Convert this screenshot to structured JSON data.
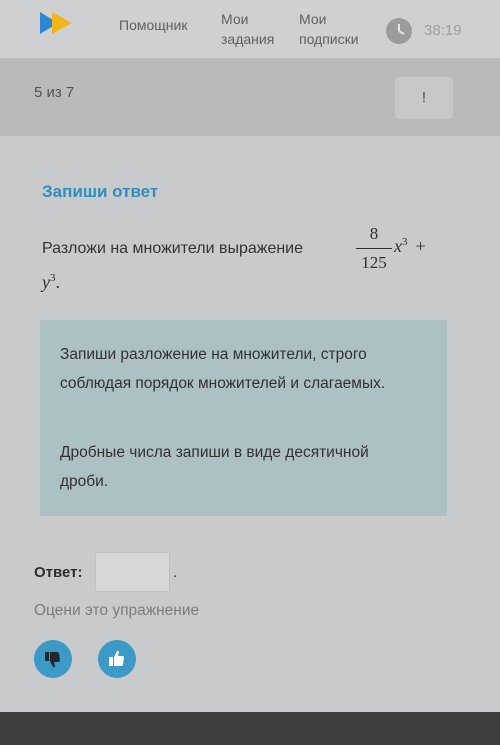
{
  "header": {
    "nav_helper": "Помощник",
    "nav_tasks_line1": "Мои",
    "nav_tasks_line2": "задания",
    "nav_subs_line1": "Мои",
    "nav_subs_line2": "подписки",
    "timer": "38:19",
    "logo_icon": "play-logo-icon",
    "clock_icon": "clock-icon"
  },
  "progress": {
    "counter": "5 из 7",
    "report_label": "!"
  },
  "exercise": {
    "heading": "Запиши ответ",
    "task_text": "Разложи на множители выражение",
    "fraction_num": "8",
    "fraction_den": "125",
    "var_x": "x",
    "exp_x": "3",
    "plus": "+",
    "var_y": "y",
    "exp_y": "3",
    "dot": "."
  },
  "hint": {
    "p1": "Запиши разложение на множители, строго соблюдая порядок множителей и слагаемых.",
    "p2": "Дробные числа запиши в виде десятичной дроби."
  },
  "answer": {
    "label": "Ответ:",
    "value": "",
    "dot": "."
  },
  "rating": {
    "label": "Оцени это упражнение",
    "down_icon": "thumbs-down-icon",
    "up_icon": "thumbs-up-icon"
  },
  "colors": {
    "accent": "#2f8ec0",
    "hint_bg": "#adc0c3",
    "button": "#3c9ac6"
  }
}
